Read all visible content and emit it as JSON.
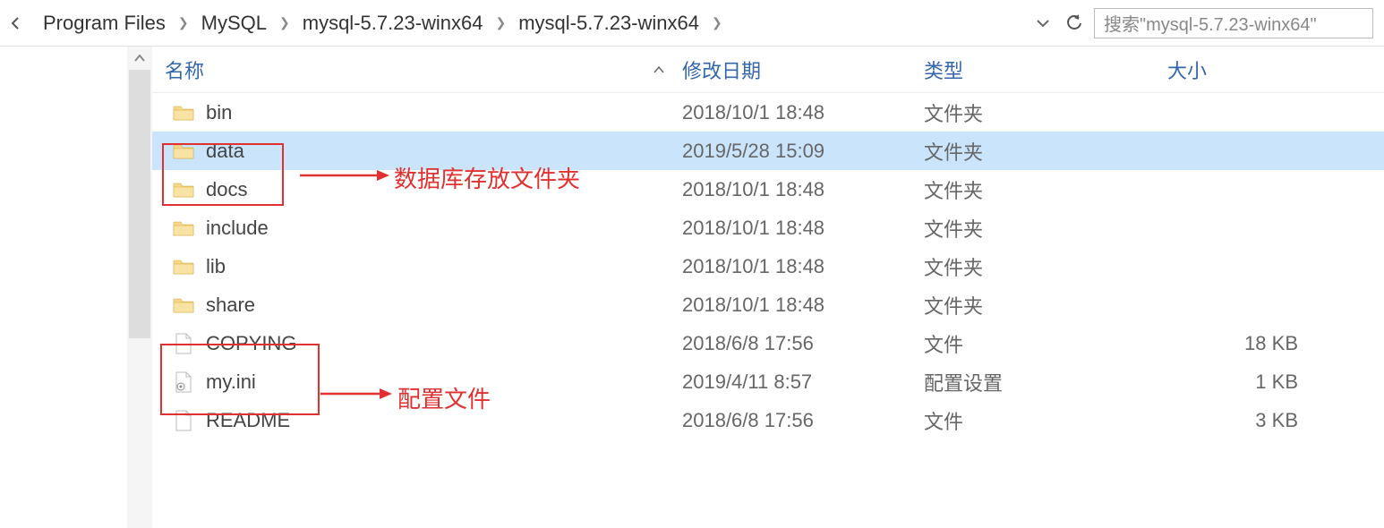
{
  "breadcrumb": {
    "items": [
      "Program Files",
      "MySQL",
      "mysql-5.7.23-winx64",
      "mysql-5.7.23-winx64"
    ]
  },
  "search": {
    "placeholder": "搜索\"mysql-5.7.23-winx64\""
  },
  "columns": {
    "name": "名称",
    "date": "修改日期",
    "type": "类型",
    "size": "大小"
  },
  "files": [
    {
      "name": "bin",
      "date": "2018/10/1 18:48",
      "type": "文件夹",
      "size": "",
      "icon": "folder",
      "selected": false
    },
    {
      "name": "data",
      "date": "2019/5/28 15:09",
      "type": "文件夹",
      "size": "",
      "icon": "folder",
      "selected": true
    },
    {
      "name": "docs",
      "date": "2018/10/1 18:48",
      "type": "文件夹",
      "size": "",
      "icon": "folder",
      "selected": false
    },
    {
      "name": "include",
      "date": "2018/10/1 18:48",
      "type": "文件夹",
      "size": "",
      "icon": "folder",
      "selected": false
    },
    {
      "name": "lib",
      "date": "2018/10/1 18:48",
      "type": "文件夹",
      "size": "",
      "icon": "folder",
      "selected": false
    },
    {
      "name": "share",
      "date": "2018/10/1 18:48",
      "type": "文件夹",
      "size": "",
      "icon": "folder",
      "selected": false
    },
    {
      "name": "COPYING",
      "date": "2018/6/8 17:56",
      "type": "文件",
      "size": "18 KB",
      "icon": "file",
      "selected": false
    },
    {
      "name": "my.ini",
      "date": "2019/4/11 8:57",
      "type": "配置设置",
      "size": "1 KB",
      "icon": "ini",
      "selected": false
    },
    {
      "name": "README",
      "date": "2018/6/8 17:56",
      "type": "文件",
      "size": "3 KB",
      "icon": "file",
      "selected": false
    }
  ],
  "annotations": {
    "data_folder": "数据库存放文件夹",
    "config_file": "配置文件"
  }
}
